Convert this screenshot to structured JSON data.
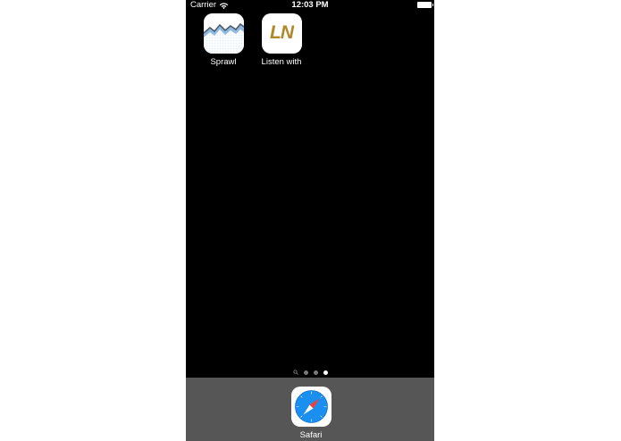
{
  "status_bar": {
    "carrier": "Carrier",
    "time": "12:03 PM",
    "wifi_icon": "wifi-icon",
    "battery_icon": "battery-icon"
  },
  "home_apps": [
    {
      "label": "Sprawl",
      "icon": "sprawl-app-icon"
    },
    {
      "label": "Listen with",
      "icon": "ln-app-icon",
      "icon_text": "LN",
      "accent": "#b0882a"
    }
  ],
  "page_indicator": {
    "pages": 3,
    "current_page": 3,
    "has_search_page": true
  },
  "dock": {
    "apps": [
      {
        "label": "Safari",
        "icon": "safari-icon"
      }
    ]
  },
  "colors": {
    "background": "#000000",
    "dock": "#565656",
    "text": "#ffffff"
  }
}
